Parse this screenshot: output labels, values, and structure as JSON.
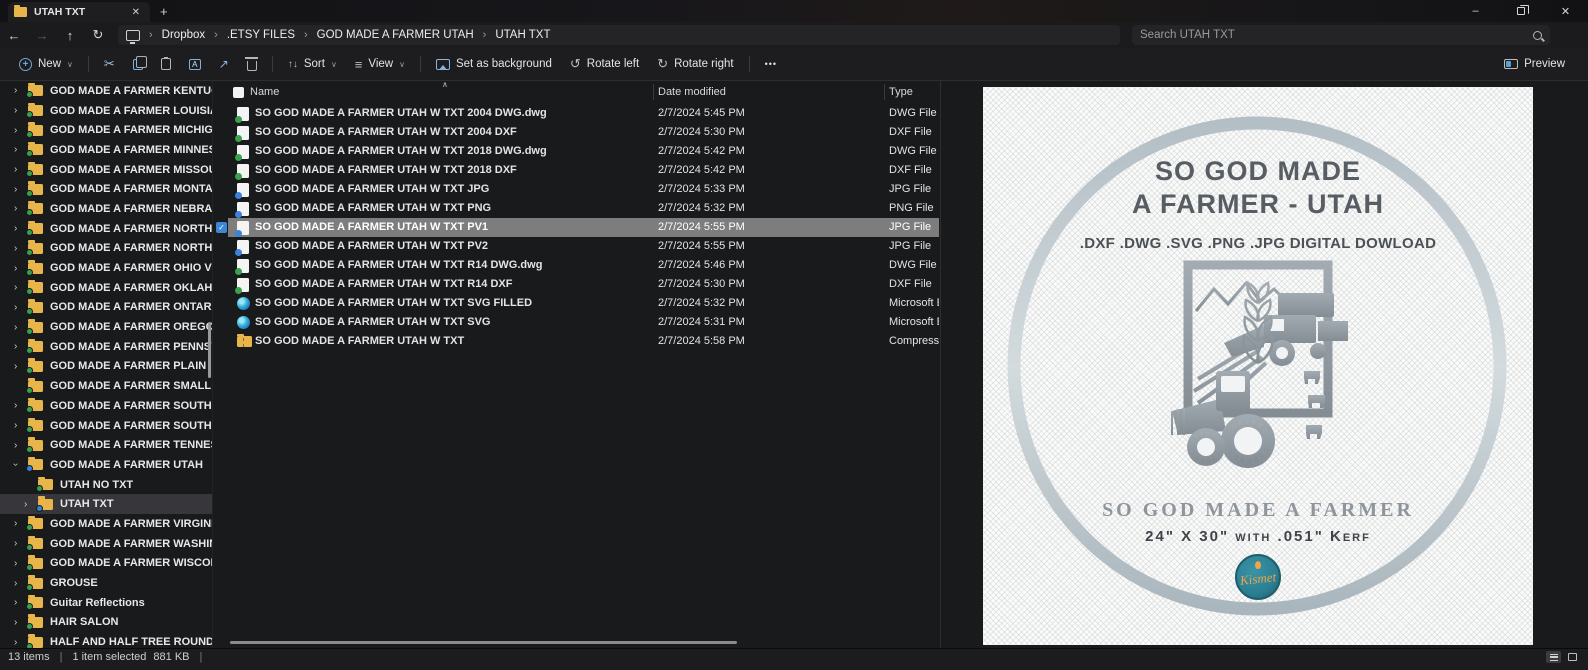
{
  "window": {
    "tab_title": "UTAH TXT",
    "new_tab": "+",
    "close": "✕",
    "minimize": "–"
  },
  "address": {
    "crumbs": [
      "Dropbox",
      ".ETSY FILES",
      "GOD MADE A FARMER UTAH",
      "UTAH TXT"
    ]
  },
  "search": {
    "placeholder": "Search UTAH TXT"
  },
  "toolbar": {
    "new": "New",
    "sort": "Sort",
    "view": "View",
    "set_as_background": "Set as background",
    "rotate_left": "Rotate left",
    "rotate_right": "Rotate right",
    "more": "•••",
    "preview": "Preview"
  },
  "columns": {
    "name": "Name",
    "date": "Date modified",
    "type": "Type"
  },
  "sidebar": {
    "items": [
      {
        "label": "GOD MADE A FARMER KENTUCKY",
        "chevron": "right",
        "badge": "green"
      },
      {
        "label": "GOD MADE A FARMER LOUISIANA",
        "chevron": "right",
        "badge": "green"
      },
      {
        "label": "GOD MADE A FARMER MICHIGAN WITH UP",
        "chevron": "right",
        "badge": "green"
      },
      {
        "label": "GOD MADE A FARMER MINNESOTA",
        "chevron": "right",
        "badge": "green"
      },
      {
        "label": "GOD MADE A FARMER MISSOURI",
        "chevron": "right",
        "badge": "green"
      },
      {
        "label": "GOD MADE A FARMER MONTANA VERSION",
        "chevron": "right",
        "badge": "green"
      },
      {
        "label": "GOD MADE A FARMER NEBRASKA",
        "chevron": "right",
        "badge": "green"
      },
      {
        "label": "GOD MADE A FARMER NORTH CAROLINA",
        "chevron": "right",
        "badge": "green"
      },
      {
        "label": "GOD MADE A FARMER NORTH DAKOTA",
        "chevron": "right",
        "badge": "green"
      },
      {
        "label": "GOD MADE A FARMER OHIO VERSION",
        "chevron": "right",
        "badge": "green"
      },
      {
        "label": "GOD MADE A FARMER OKLAHOMA",
        "chevron": "right",
        "badge": "green"
      },
      {
        "label": "GOD MADE A FARMER ONTARIO",
        "chevron": "right",
        "badge": "green"
      },
      {
        "label": "GOD MADE A FARMER OREGON",
        "chevron": "right",
        "badge": "green"
      },
      {
        "label": "GOD MADE A FARMER PENNSYLVANIA",
        "chevron": "right",
        "badge": "green"
      },
      {
        "label": "GOD MADE A FARMER PLAIN",
        "chevron": "right",
        "badge": "green"
      },
      {
        "label": "GOD MADE A FARMER SMALL MONTANA VERSIO",
        "chevron": "none",
        "badge": "green"
      },
      {
        "label": "GOD MADE A FARMER SOUTH CAROLINA",
        "chevron": "right",
        "badge": "green"
      },
      {
        "label": "GOD MADE A FARMER SOUTH DAKOTA",
        "chevron": "right",
        "badge": "green"
      },
      {
        "label": "GOD MADE A FARMER TENNESSEE",
        "chevron": "right",
        "badge": "green"
      },
      {
        "label": "GOD MADE A FARMER UTAH",
        "chevron": "down",
        "badge": "blue"
      },
      {
        "label": "UTAH NO TXT",
        "chevron": "none",
        "badge": "green",
        "child": true
      },
      {
        "label": "UTAH TXT",
        "chevron": "right",
        "badge": "blue",
        "child": true,
        "selected": true
      },
      {
        "label": "GOD MADE A FARMER VIRGINIA",
        "chevron": "right",
        "badge": "green"
      },
      {
        "label": "GOD MADE A FARMER WASHINGTON",
        "chevron": "right",
        "badge": "green"
      },
      {
        "label": "GOD MADE A FARMER WISCONSIN",
        "chevron": "right",
        "badge": "green"
      },
      {
        "label": "GROUSE",
        "chevron": "right",
        "badge": "green"
      },
      {
        "label": "Guitar Reflections",
        "chevron": "right",
        "badge": "green"
      },
      {
        "label": "HAIR SALON",
        "chevron": "right",
        "badge": "green"
      },
      {
        "label": "HALF AND HALF TREE ROUND",
        "chevron": "right",
        "badge": "green"
      }
    ]
  },
  "files": {
    "rows": [
      {
        "name": "SO GOD MADE A FARMER UTAH W TXT 2004 DWG.dwg",
        "date": "2/7/2024 5:45 PM",
        "type": "DWG File",
        "icon": "cad"
      },
      {
        "name": "SO GOD MADE A FARMER UTAH W TXT 2004 DXF",
        "date": "2/7/2024 5:30 PM",
        "type": "DXF File",
        "icon": "cad"
      },
      {
        "name": "SO GOD MADE A FARMER UTAH W TXT 2018 DWG.dwg",
        "date": "2/7/2024 5:42 PM",
        "type": "DWG File",
        "icon": "cad"
      },
      {
        "name": "SO GOD MADE A FARMER UTAH W TXT 2018 DXF",
        "date": "2/7/2024 5:42 PM",
        "type": "DXF File",
        "icon": "cad"
      },
      {
        "name": "SO GOD MADE A FARMER UTAH W TXT JPG",
        "date": "2/7/2024 5:33 PM",
        "type": "JPG File",
        "icon": "image"
      },
      {
        "name": "SO GOD MADE A FARMER UTAH W TXT PNG",
        "date": "2/7/2024 5:32 PM",
        "type": "PNG File",
        "icon": "image"
      },
      {
        "name": "SO GOD MADE A FARMER UTAH W TXT PV1",
        "date": "2/7/2024 5:55 PM",
        "type": "JPG File",
        "icon": "image",
        "selected": true
      },
      {
        "name": "SO GOD MADE A FARMER UTAH W TXT PV2",
        "date": "2/7/2024 5:55 PM",
        "type": "JPG File",
        "icon": "image"
      },
      {
        "name": "SO GOD MADE A FARMER UTAH W TXT R14 DWG.dwg",
        "date": "2/7/2024 5:46 PM",
        "type": "DWG File",
        "icon": "cad"
      },
      {
        "name": "SO GOD MADE A FARMER UTAH W TXT R14 DXF",
        "date": "2/7/2024 5:30 PM",
        "type": "DXF File",
        "icon": "cad"
      },
      {
        "name": "SO GOD MADE A FARMER UTAH W TXT SVG FILLED",
        "date": "2/7/2024 5:32 PM",
        "type": "Microsoft Edge",
        "icon": "edge"
      },
      {
        "name": "SO GOD MADE A FARMER UTAH W TXT SVG",
        "date": "2/7/2024 5:31 PM",
        "type": "Microsoft Edge",
        "icon": "edge"
      },
      {
        "name": "SO GOD MADE A FARMER UTAH W TXT",
        "date": "2/7/2024 5:58 PM",
        "type": "Compressed (zip",
        "icon": "zip"
      }
    ]
  },
  "status": {
    "items_count": "13 items",
    "selection": "1 item selected",
    "size": "881 KB"
  },
  "preview": {
    "title_line1": "SO GOD MADE",
    "title_line2": "A FARMER - UTAH",
    "formats": ".DXF .DWG .SVG .PNG .JPG DIGITAL DOWLOAD",
    "plate_text": "SO GOD MADE A FARMER",
    "size_text": "24\" X 30\" with .051\" Kerf",
    "logo_text": "Kismet"
  },
  "colors": {
    "accent_blue": "#3a87d6",
    "folder_yellow": "#e8b54a",
    "sync_green": "#35a14e",
    "sync_blue": "#2f86d6",
    "selection_gray": "#7d7d7d",
    "logo_teal": "#2b7f93",
    "logo_orange": "#f0a548"
  }
}
